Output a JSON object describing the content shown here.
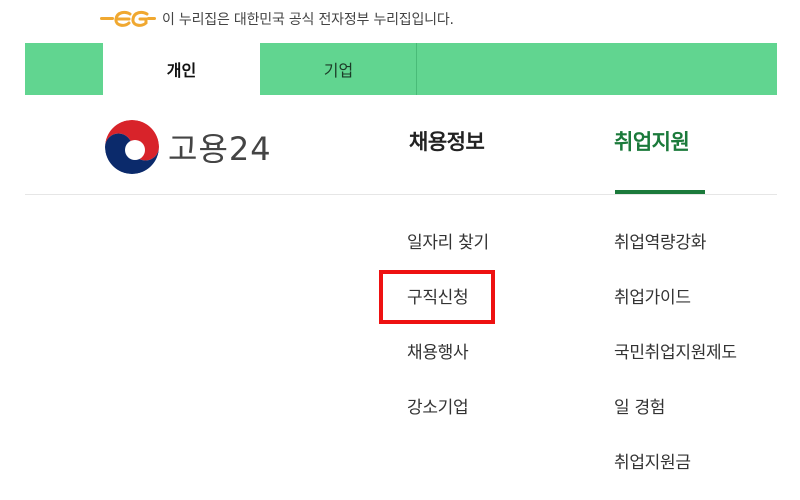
{
  "gov_banner": {
    "logo_icon": "eg-icon",
    "text": "이 누리집은 대한민국 공식 전자정부 누리집입니다.",
    "logo_color": "#f0a830"
  },
  "tabs": [
    {
      "label": "개인",
      "active": true
    },
    {
      "label": "기업",
      "active": false
    }
  ],
  "header": {
    "logo_icon": "taegeuk-icon",
    "logo_text": "고용24",
    "nav": [
      {
        "label": "채용정보",
        "active": false
      },
      {
        "label": "취업지원",
        "active": true
      }
    ]
  },
  "submenu_jobs": [
    "일자리 찾기",
    "구직신청",
    "채용행사",
    "강소기업"
  ],
  "submenu_support": [
    "취업역량강화",
    "취업가이드",
    "국민취업지원제도",
    "일 경험",
    "취업지원금"
  ],
  "highlighted_item": "구직신청",
  "colors": {
    "tab_bar": "#61d590",
    "accent": "#1b7a3b",
    "highlight": "#ee1111"
  }
}
